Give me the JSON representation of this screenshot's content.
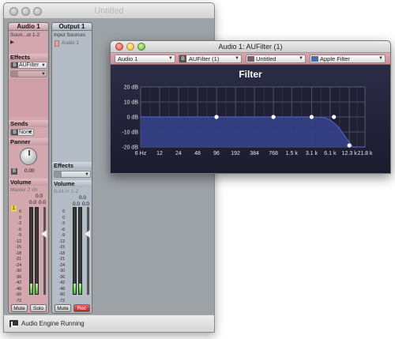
{
  "mixer": {
    "title": "Untitled",
    "status": "Audio Engine Running",
    "strips": [
      {
        "name": "Audio 1",
        "source": "Soun...ut 1-2",
        "source_arrow": "▶",
        "effects_label": "Effects",
        "effect_bypass": "B",
        "effect_name": "AUFilter",
        "sends_label": "Sends",
        "send_bypass": "B",
        "send_value": "None",
        "panner_label": "Panner",
        "pan_value": "0.00",
        "pan_badge": "B",
        "volume_label": "Volume",
        "volume_mode": "Master 2 ch",
        "volume_value": "0.0",
        "meter_values": [
          "0.0",
          "0.0"
        ],
        "meter_levels": [
          0.12,
          0.12
        ],
        "solo_icon": "1",
        "scale": [
          "6",
          "0",
          "-3",
          "-6",
          "-9",
          "-12",
          "-15",
          "-18",
          "-21",
          "-24",
          "-30",
          "-36",
          "-42",
          "-48",
          "-60",
          "-72"
        ],
        "buttons": [
          "Mute",
          "Solo"
        ]
      },
      {
        "name": "Output 1",
        "source": "Input Sources",
        "input_item": "Audio 1",
        "effects_label": "Effects",
        "volume_label": "Volume",
        "volume_mode": "Built-in 1-2",
        "volume_value": "0.0",
        "meter_values": [
          "0.0",
          "0.0"
        ],
        "meter_levels": [
          0.12,
          0.12
        ],
        "scale": [
          "6",
          "0",
          "-3",
          "-6",
          "-9",
          "-12",
          "-15",
          "-18",
          "-21",
          "-24",
          "-30",
          "-36",
          "-42",
          "-48",
          "-60",
          "-72"
        ],
        "buttons": [
          "Mute",
          "Rec"
        ]
      }
    ]
  },
  "au_window": {
    "title": "Audio 1: AUFilter (1)",
    "menus": {
      "track": "Audio 1",
      "effect_badge": "B",
      "effect": "AUFilter (1)",
      "preset": "Untitled",
      "manufacturer": "Apple Filter"
    }
  },
  "chart_data": {
    "type": "line",
    "title": "Filter",
    "xscale": "log",
    "x_tick_labels": [
      "6 Hz",
      "12",
      "24",
      "48",
      "96",
      "192",
      "384",
      "768",
      "1.5 k",
      "3.1 k",
      "6.1 k",
      "12.3 k",
      "21.8 k"
    ],
    "x_ticks_hz": [
      6,
      12,
      24,
      48,
      96,
      192,
      384,
      768,
      1500,
      3100,
      6100,
      12300,
      21800
    ],
    "y_tick_labels": [
      "20 dB",
      "10 dB",
      "0 dB",
      "-10 dB",
      "-20 dB"
    ],
    "y_ticks": [
      20,
      10,
      0,
      -10,
      -20
    ],
    "ylim": [
      -20,
      20
    ],
    "xlim_hz": [
      6,
      21800
    ],
    "grid": true,
    "series": [
      {
        "x": [
          6,
          96,
          768,
          3100,
          5000,
          6100,
          8000,
          11000,
          14000,
          21800
        ],
        "y": [
          0,
          0,
          0,
          0,
          -0.5,
          -2,
          -6,
          -14,
          -20,
          -20
        ]
      }
    ],
    "control_points": {
      "x": [
        96,
        768,
        3100,
        7000,
        12300
      ],
      "y": [
        0,
        0,
        0,
        0,
        -19
      ]
    },
    "colors": {
      "background": "#1f2034",
      "fill": "#35418a",
      "line": "#4f5dbd",
      "grid": "#5a5b74",
      "point": "#ffffff"
    }
  }
}
